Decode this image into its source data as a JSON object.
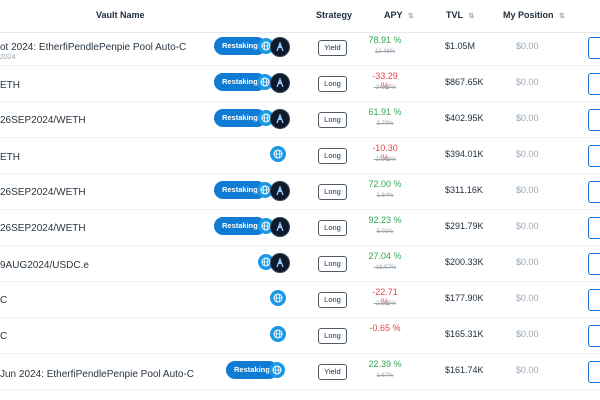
{
  "columns": {
    "vault_name": "Vault Name",
    "strategy": "Strategy",
    "apy": "APY",
    "tvl": "TVL",
    "my_position": "My Position"
  },
  "rows": [
    {
      "name": "ot 2024: EtherfiPendlePenpie Pool Auto-C",
      "sub": "2024",
      "badge": "Restaking",
      "strategy": "Yield",
      "apy": "78.91 %",
      "apy_dir": "pos",
      "apy_base": "12.46%",
      "tvl": "$1.05M",
      "position": "$0.00"
    },
    {
      "name": "ETH",
      "sub": "",
      "badge": "Restaking",
      "strategy": "Long",
      "apy": "-33.29 %",
      "apy_dir": "neg",
      "apy_base": "-34.67%",
      "tvl": "$867.65K",
      "position": "$0.00"
    },
    {
      "name": "26SEP2024/WETH",
      "sub": "",
      "badge": "Restaking",
      "strategy": "Long",
      "apy": "61.91 %",
      "apy_dir": "pos",
      "apy_base": "3.79%",
      "tvl": "$402.95K",
      "position": "$0.00"
    },
    {
      "name": "ETH",
      "sub": "",
      "badge": "",
      "strategy": "Long",
      "apy": "-10.30 %",
      "apy_dir": "neg",
      "apy_base": "-10.46%",
      "tvl": "$394.01K",
      "position": "$0.00"
    },
    {
      "name": "26SEP2024/WETH",
      "sub": "",
      "badge": "Restaking",
      "strategy": "Long",
      "apy": "72.00 %",
      "apy_dir": "pos",
      "apy_base": "1.64%",
      "tvl": "$311.16K",
      "position": "$0.00"
    },
    {
      "name": "26SEP2024/WETH",
      "sub": "",
      "badge": "Restaking",
      "strategy": "Long",
      "apy": "92.23 %",
      "apy_dir": "pos",
      "apy_base": "5.01%",
      "tvl": "$291.79K",
      "position": "$0.00"
    },
    {
      "name": "9AUG2024/USDC.e",
      "sub": "",
      "badge": "",
      "strategy": "Long",
      "apy": "27.04 %",
      "apy_dir": "pos",
      "apy_base": "-18.97%",
      "tvl": "$200.33K",
      "position": "$0.00"
    },
    {
      "name": "C",
      "sub": "",
      "badge": "",
      "strategy": "Long",
      "apy": "-22.71 %",
      "apy_dir": "neg",
      "apy_base": "-22.85%",
      "tvl": "$177.90K",
      "position": "$0.00"
    },
    {
      "name": "C",
      "sub": "",
      "badge": "",
      "strategy": "Long",
      "apy": "-0.65 %",
      "apy_dir": "neg",
      "apy_base": "",
      "tvl": "$165.31K",
      "position": "$0.00"
    },
    {
      "name": "Jun 2024: EtherfiPendlePenpie Pool Auto-C",
      "sub": "",
      "badge": "Restaking",
      "strategy": "Yield",
      "apy": "22.39 %",
      "apy_dir": "pos",
      "apy_base": "1.67%",
      "tvl": "$161.74K",
      "position": "$0.00"
    }
  ],
  "icons": {
    "globe": "globe-icon",
    "pendle": "pendle-icon",
    "sort": "sort-icon"
  },
  "colors": {
    "accent": "#1a6fd0",
    "badge": "#0f7bd3",
    "positive": "#2ea84e",
    "negative": "#e0454f",
    "muted": "#9aa6b2"
  }
}
